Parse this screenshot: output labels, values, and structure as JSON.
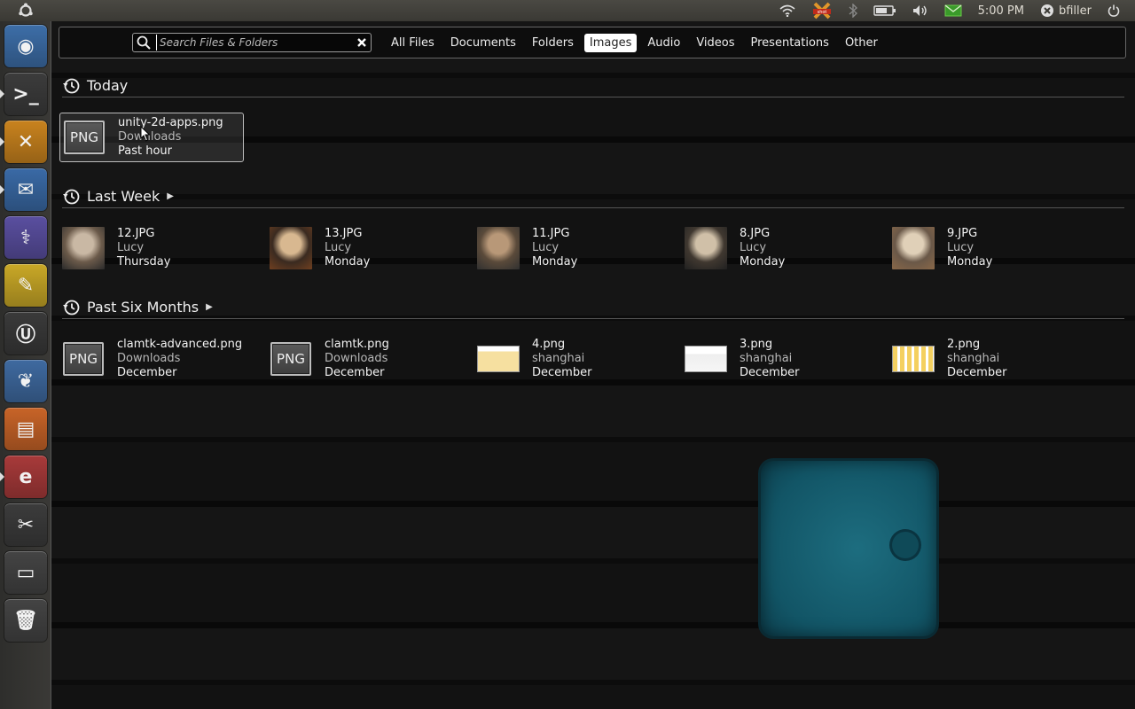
{
  "panel": {
    "time": "5:00 PM",
    "user": "bfiller",
    "tray_icons": [
      "wifi-icon",
      "shutter-icon",
      "bluetooth-icon",
      "battery-icon",
      "volume-icon",
      "mail-icon"
    ]
  },
  "launcher": {
    "items": [
      {
        "name": "chromium",
        "icon": "chromium-icon",
        "color": "#3d6ea8",
        "running": false
      },
      {
        "name": "terminal",
        "icon": "terminal-icon",
        "color": "#3c3c3c",
        "running": true
      },
      {
        "name": "shutter",
        "icon": "shutter-icon",
        "color": "#c9831e",
        "running": true
      },
      {
        "name": "thunderbird",
        "icon": "thunderbird-icon",
        "color": "#3a6aa6",
        "running": true
      },
      {
        "name": "eclipse-hydra",
        "icon": "hydra-icon",
        "color": "#5a4fa0",
        "running": false
      },
      {
        "name": "text-editor",
        "icon": "text-editor-icon",
        "color": "#c9a827",
        "running": false
      },
      {
        "name": "ubuntu-one",
        "icon": "ubuntu-one-icon",
        "color": "#3a3a3a",
        "running": false
      },
      {
        "name": "gimp-feet",
        "icon": "feet-icon",
        "color": "#3f6aa0",
        "running": false
      },
      {
        "name": "presentation",
        "icon": "presentation-icon",
        "color": "#c86428",
        "running": false
      },
      {
        "name": "e-app",
        "icon": "e-icon",
        "color": "#a83a3a",
        "running": true
      },
      {
        "name": "screenshot-tool",
        "icon": "scissors-icon",
        "color": "#3c3c3c",
        "running": false
      },
      {
        "name": "files",
        "icon": "folder-icon",
        "color": "#444444",
        "running": false
      },
      {
        "name": "trash",
        "icon": "trash-icon",
        "color": "#444444",
        "running": false
      }
    ]
  },
  "search": {
    "placeholder": "Search Files & Folders",
    "value": ""
  },
  "filters": {
    "items": [
      "All Files",
      "Documents",
      "Folders",
      "Images",
      "Audio",
      "Videos",
      "Presentations",
      "Other"
    ],
    "active": "Images"
  },
  "sections": {
    "today": {
      "title": "Today",
      "items": [
        {
          "name": "unity-2d-apps.png",
          "location": "Downloads",
          "when": "Past hour",
          "thumb": "png"
        }
      ]
    },
    "last_week": {
      "title": "Last Week",
      "items": [
        {
          "name": "12.JPG",
          "location": "Lucy",
          "when": "Thursday",
          "thumb": "photo"
        },
        {
          "name": "13.JPG",
          "location": "Lucy",
          "when": "Monday",
          "thumb": "photo"
        },
        {
          "name": "11.JPG",
          "location": "Lucy",
          "when": "Monday",
          "thumb": "photo"
        },
        {
          "name": "8.JPG",
          "location": "Lucy",
          "when": "Monday",
          "thumb": "photo"
        },
        {
          "name": "9.JPG",
          "location": "Lucy",
          "when": "Monday",
          "thumb": "photo"
        }
      ]
    },
    "past_six_months": {
      "title": "Past Six Months",
      "items": [
        {
          "name": "clamtk-advanced.png",
          "location": "Downloads",
          "when": "December",
          "thumb": "png"
        },
        {
          "name": "clamtk.png",
          "location": "Downloads",
          "when": "December",
          "thumb": "png"
        },
        {
          "name": "4.png",
          "location": "shanghai",
          "when": "December",
          "thumb": "screenshot"
        },
        {
          "name": "3.png",
          "location": "shanghai",
          "when": "December",
          "thumb": "screenshot"
        },
        {
          "name": "2.png",
          "location": "shanghai",
          "when": "December",
          "thumb": "screenshot"
        }
      ]
    }
  },
  "png_label": "PNG"
}
